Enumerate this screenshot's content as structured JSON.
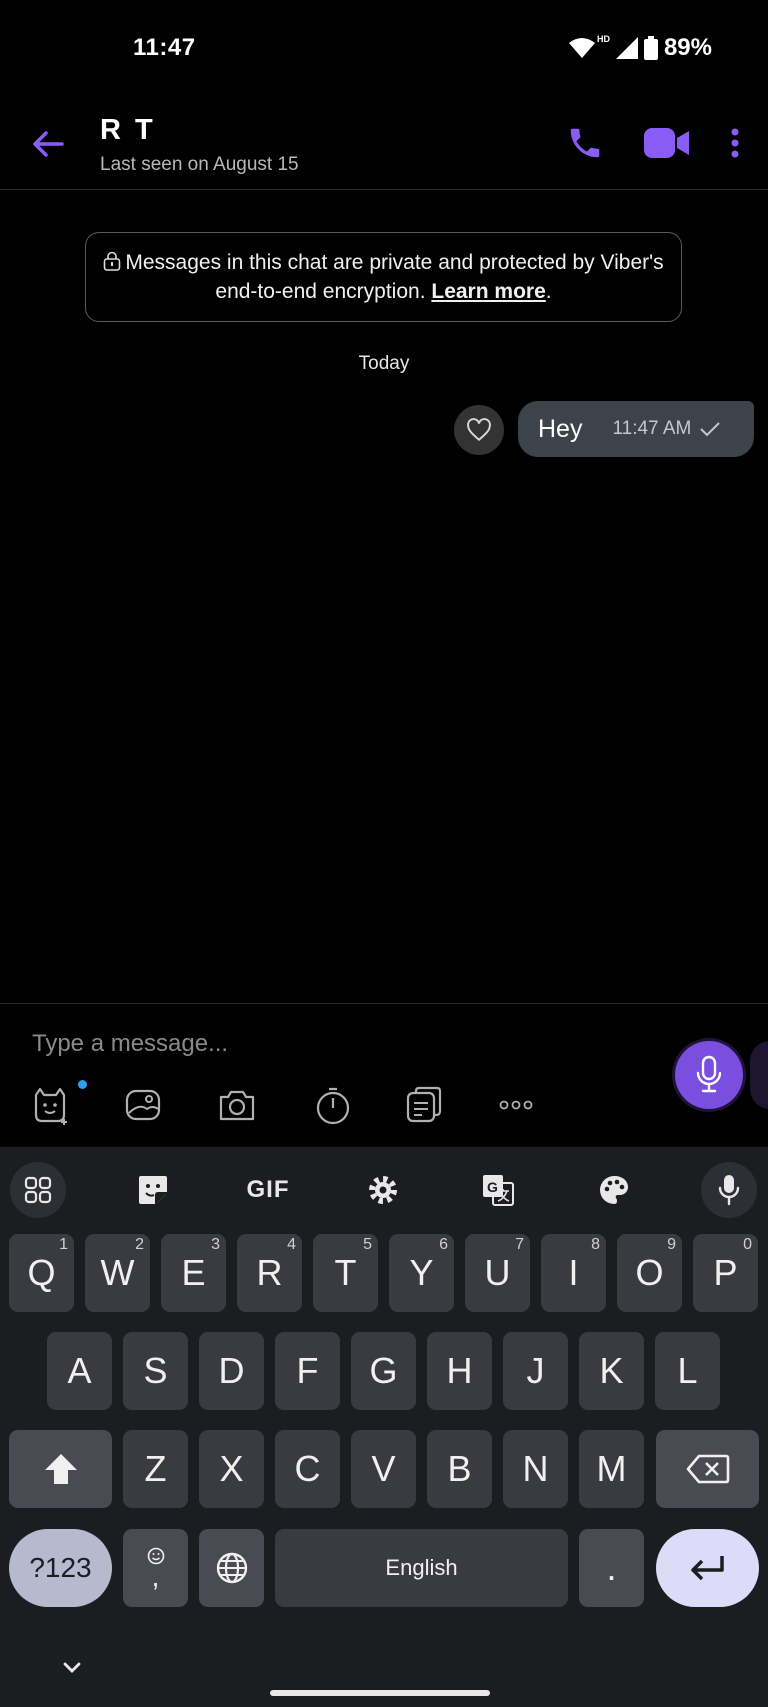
{
  "status_bar": {
    "time": "11:47",
    "battery": "89%",
    "network_badge": "HD"
  },
  "header": {
    "contact_name": "R T",
    "last_seen": "Last seen on August 15",
    "icons": [
      "back-arrow-icon",
      "phone-icon",
      "video-camera-icon",
      "more-vert-icon"
    ],
    "accent_color": "#8a5cf6"
  },
  "notice": {
    "text_before": "Messages in this chat are private and protected by Viber's end-to-end encryption.",
    "link": "Learn more",
    "text_after": "."
  },
  "date_separator": "Today",
  "messages": [
    {
      "text": "Hey",
      "time": "11:47 AM",
      "status": "sent",
      "direction": "outgoing"
    }
  ],
  "composer": {
    "placeholder": "Type a message...",
    "tools": [
      "sticker-icon",
      "gallery-icon",
      "camera-icon",
      "timer-icon",
      "notes-icon",
      "more-horiz-icon"
    ]
  },
  "keyboard": {
    "toolbar": [
      "apps-grid-icon",
      "sticker-icon",
      "GIF",
      "settings-icon",
      "translate-icon",
      "palette-icon",
      "mic-icon"
    ],
    "gif_label": "GIF",
    "row1": [
      {
        "k": "Q",
        "h": "1"
      },
      {
        "k": "W",
        "h": "2"
      },
      {
        "k": "E",
        "h": "3"
      },
      {
        "k": "R",
        "h": "4"
      },
      {
        "k": "T",
        "h": "5"
      },
      {
        "k": "Y",
        "h": "6"
      },
      {
        "k": "U",
        "h": "7"
      },
      {
        "k": "I",
        "h": "8"
      },
      {
        "k": "O",
        "h": "9"
      },
      {
        "k": "P",
        "h": "0"
      }
    ],
    "row2": [
      "A",
      "S",
      "D",
      "F",
      "G",
      "H",
      "J",
      "K",
      "L"
    ],
    "row3": [
      "Z",
      "X",
      "C",
      "V",
      "B",
      "N",
      "M"
    ],
    "symbols_label": "?123",
    "comma": ",",
    "space_label": "English",
    "period": "."
  }
}
